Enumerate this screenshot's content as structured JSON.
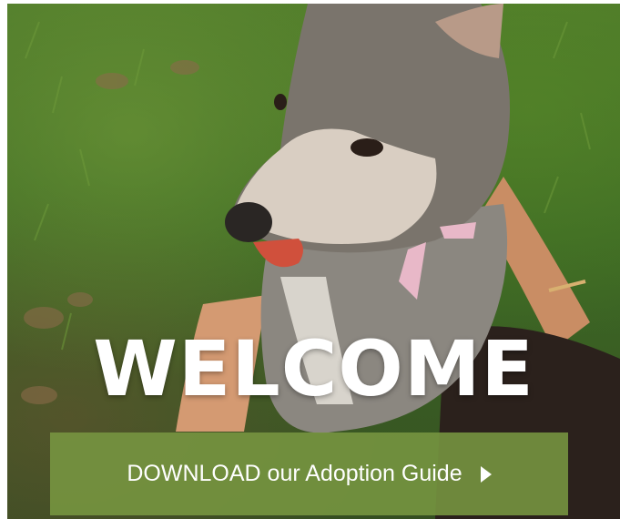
{
  "hero": {
    "headline": "WELCOME",
    "image_subject": "dog-photo"
  },
  "cta": {
    "label": "DOWNLOAD our Adoption Guide",
    "icon": "chevron-right-icon"
  },
  "colors": {
    "cta_background": "#7a9641",
    "text": "#ffffff"
  }
}
